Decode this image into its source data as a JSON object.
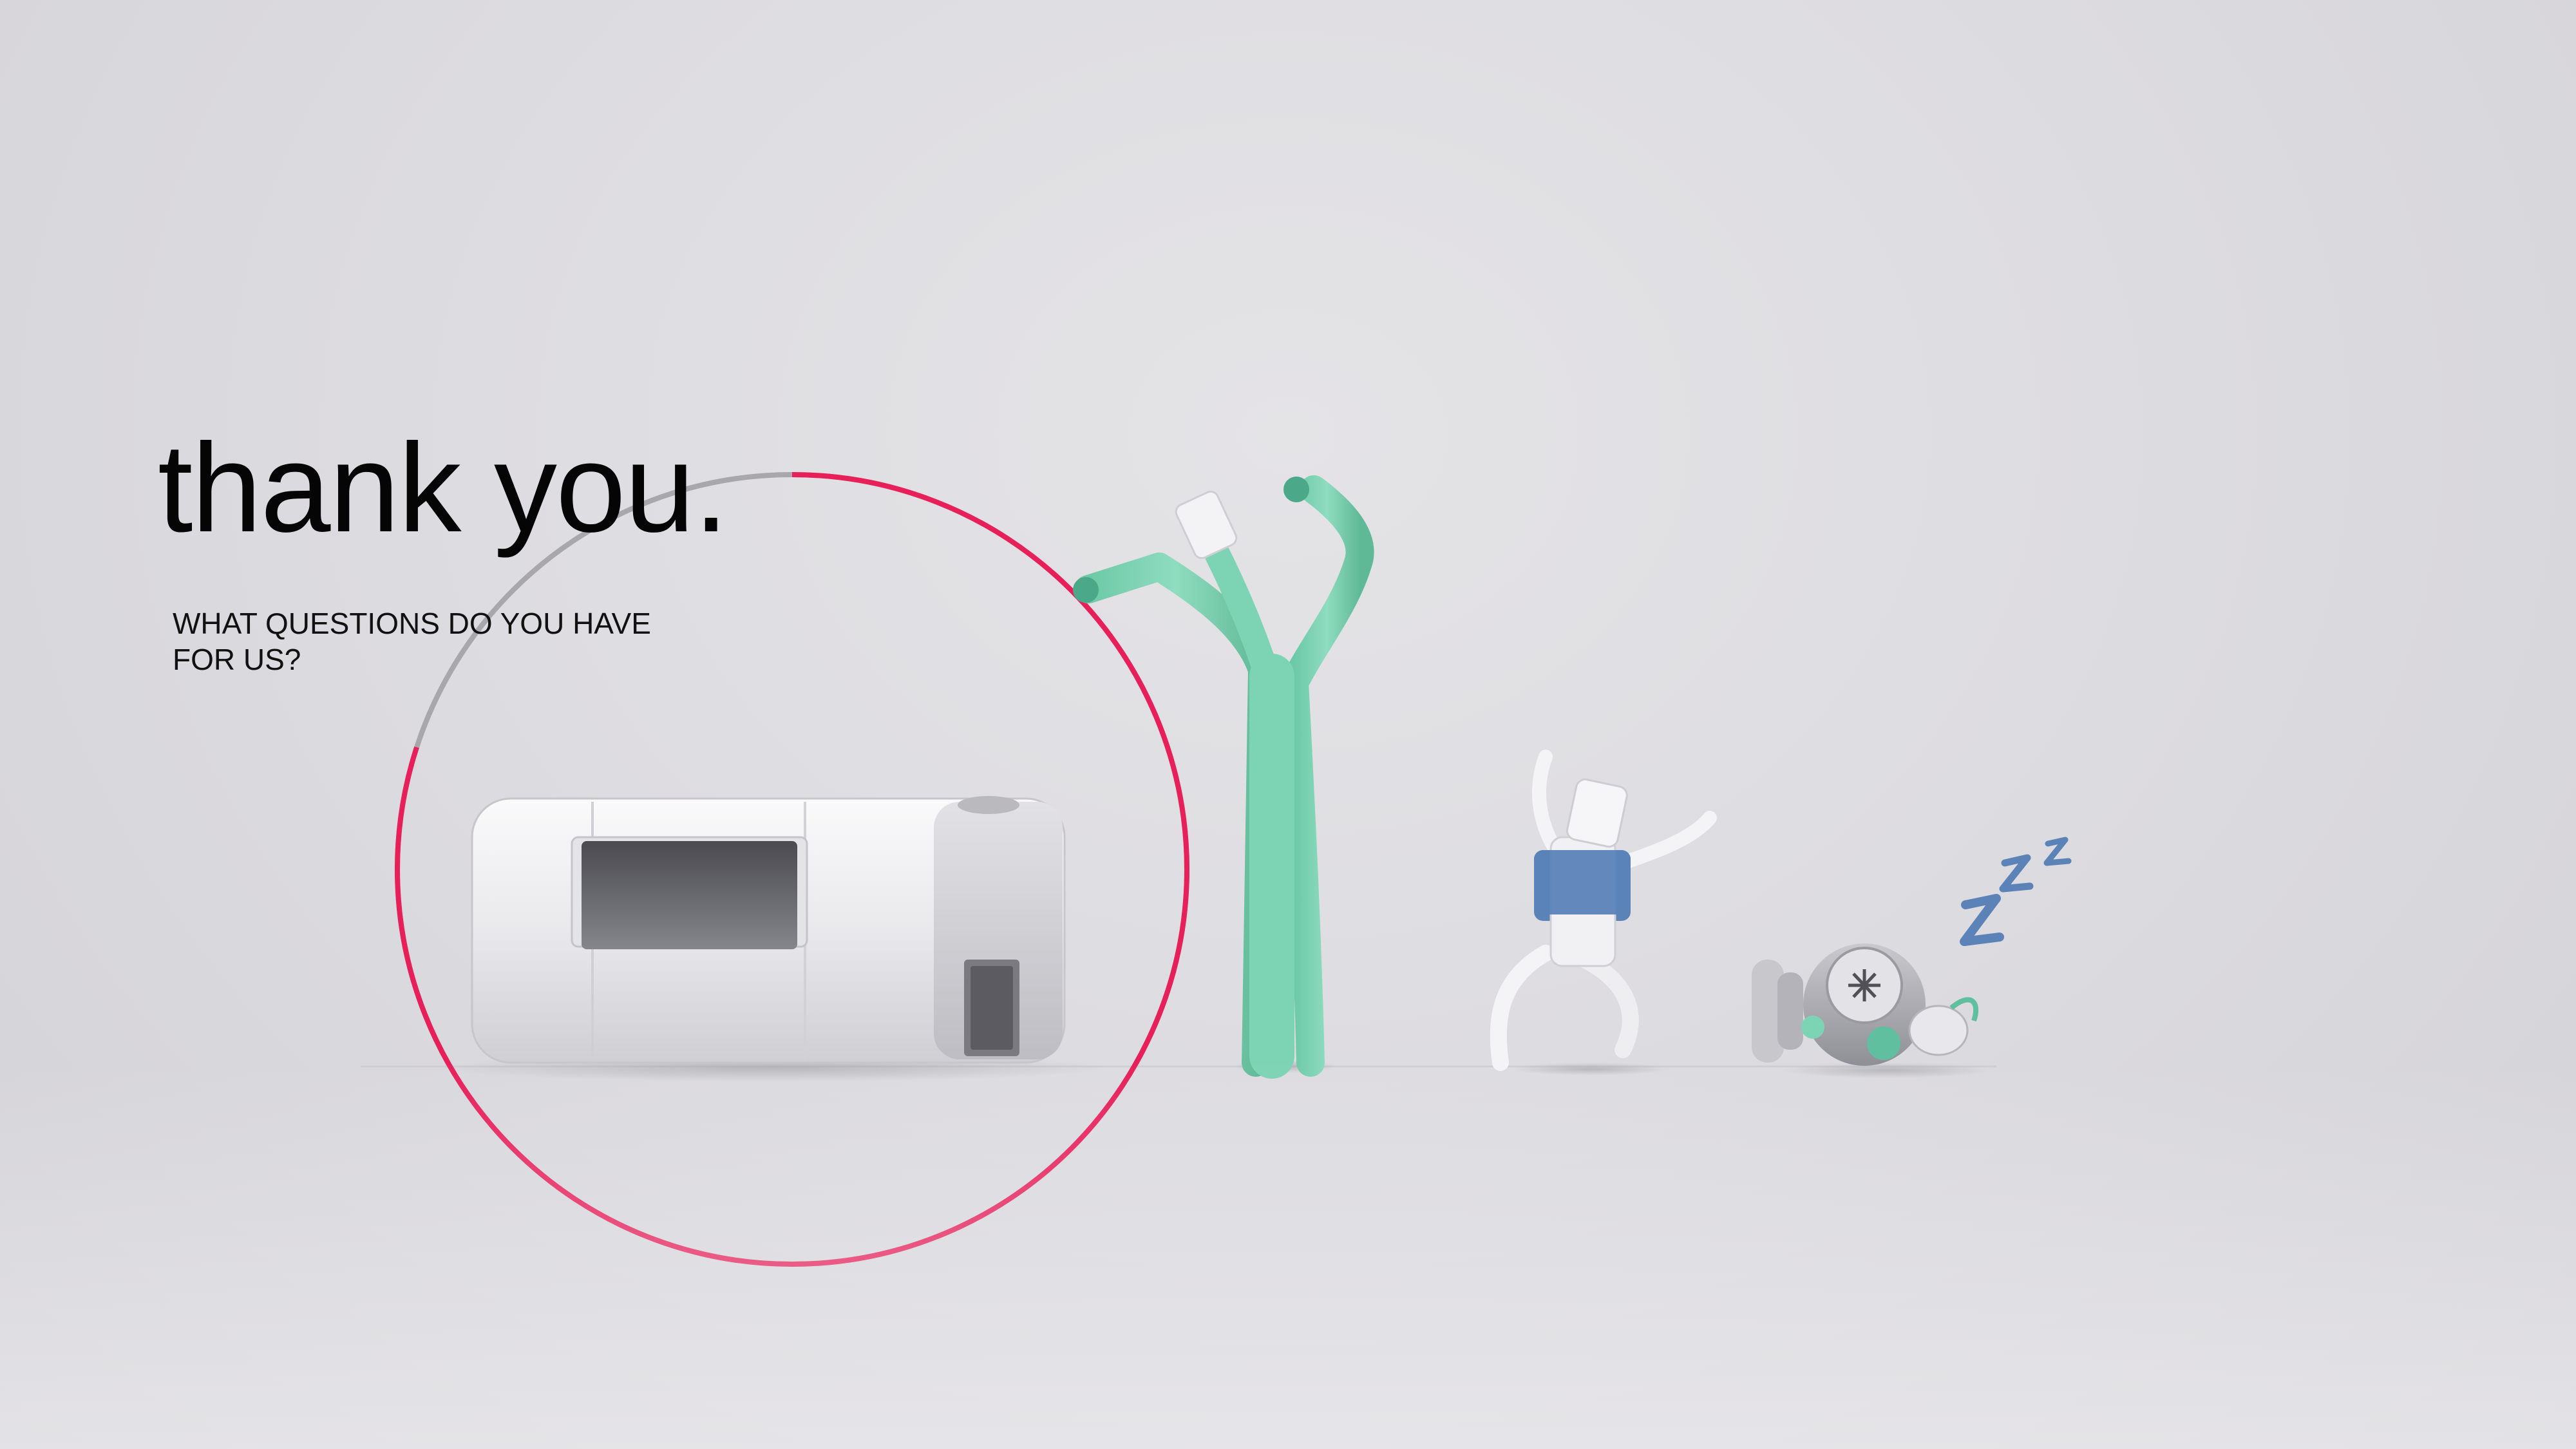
{
  "slide": {
    "title": "thank you.",
    "subtitle": "WHAT QUESTIONS DO YOU HAVE FOR US?"
  },
  "progress_ring": {
    "progress_fraction": 0.8,
    "progress_color": "#e8205a",
    "track_color": "#a8a8ac"
  },
  "illustration": {
    "characters": [
      "device-pod",
      "wacky-tube-figure",
      "dancing-figure",
      "sleeping-figure"
    ],
    "accent_teal": "#7dd4b4",
    "accent_blue": "#5b83b8"
  }
}
